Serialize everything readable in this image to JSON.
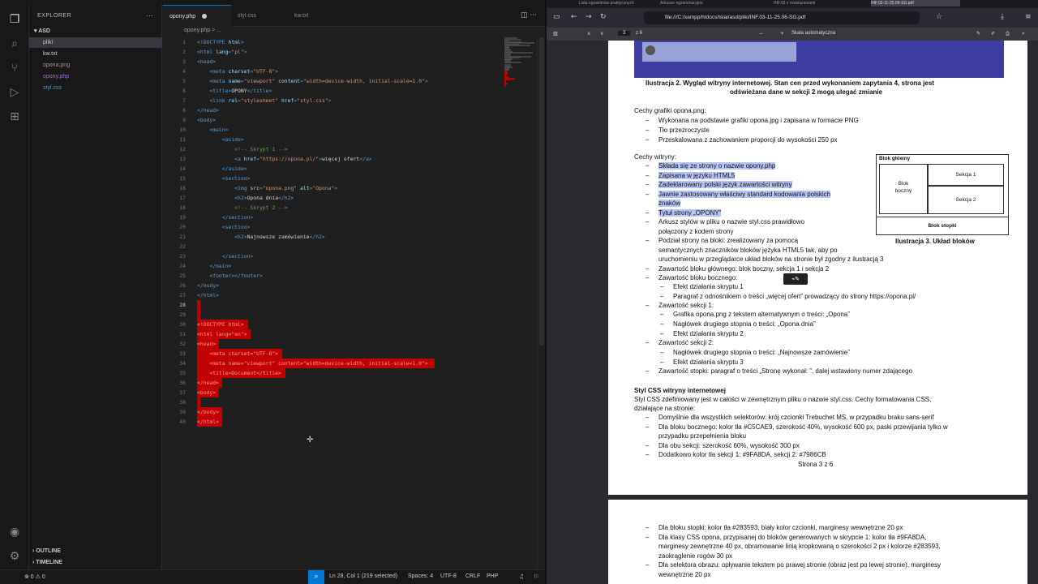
{
  "vscode": {
    "explorer_title": "EXPLORER",
    "root_folder": "ASD",
    "files": [
      {
        "name": "pliki",
        "kind": "folder",
        "color": "#c5c5c5"
      },
      {
        "name": "kw.txt",
        "kind": "txt",
        "color": "#cccccc"
      },
      {
        "name": "opona.png",
        "kind": "png",
        "color": "#b48ead"
      },
      {
        "name": "opony.php",
        "kind": "php",
        "color": "#a074c4"
      },
      {
        "name": "styl.css",
        "kind": "css",
        "color": "#519aba"
      }
    ],
    "outline_label": "OUTLINE",
    "timeline_label": "TIMELINE",
    "tabs": [
      {
        "label": "opony.php",
        "active": true,
        "dirty": true
      },
      {
        "label": "styl.css",
        "active": false,
        "dirty": false
      },
      {
        "label": "kw.txt",
        "active": false,
        "dirty": false
      }
    ],
    "breadcrumb": "opony.php > ...",
    "code_lines": [
      {
        "n": "1",
        "html": "<span class='kw'>&lt;!DOCTYPE</span> <span class='at'>html</span><span class='kw'>&gt;</span>"
      },
      {
        "n": "2",
        "html": "<span class='kw'>&lt;html</span> <span class='at'>lang</span>=<span class='st'>\"pl\"</span><span class='kw'>&gt;</span>"
      },
      {
        "n": "3",
        "html": "<span class='kw'>&lt;head&gt;</span>"
      },
      {
        "n": "4",
        "html": "    <span class='kw'>&lt;meta</span> <span class='at'>charset</span>=<span class='st'>\"UTF-8\"</span><span class='kw'>&gt;</span>"
      },
      {
        "n": "5",
        "html": "    <span class='kw'>&lt;meta</span> <span class='at'>name</span>=<span class='st'>\"viewport\"</span> <span class='at'>content</span>=<span class='st'>\"width=device-width, initial-scale=1.0\"</span><span class='kw'>&gt;</span>"
      },
      {
        "n": "6",
        "html": "    <span class='kw'>&lt;title&gt;</span><span class='tx'>OPONY</span><span class='kw'>&lt;/title&gt;</span>"
      },
      {
        "n": "7",
        "html": "    <span class='kw'>&lt;link</span> <span class='at'>rel</span>=<span class='st'>\"stylesheet\"</span> <span class='at'>href</span>=<span class='st'>\"styl.css\"</span><span class='kw'>&gt;</span>"
      },
      {
        "n": "8",
        "html": "<span class='kw'>&lt;/head&gt;</span>"
      },
      {
        "n": "9",
        "html": "<span class='kw'>&lt;body&gt;</span>"
      },
      {
        "n": "10",
        "html": "    <span class='kw'>&lt;main&gt;</span>"
      },
      {
        "n": "11",
        "html": "        <span class='kw'>&lt;aside&gt;</span>"
      },
      {
        "n": "12",
        "html": "            <span class='cm'>&lt;!-- Skrypt 1 --&gt;</span>"
      },
      {
        "n": "13",
        "html": "            <span class='kw'>&lt;a</span> <span class='at'>href</span>=<span class='st'>\"https://opona.pl/\"</span><span class='kw'>&gt;</span><span class='tx'>więcej ofert</span><span class='kw'>&lt;/a&gt;</span>"
      },
      {
        "n": "14",
        "html": "        <span class='kw'>&lt;/aside&gt;</span>"
      },
      {
        "n": "15",
        "html": "        <span class='kw'>&lt;section&gt;</span>"
      },
      {
        "n": "16",
        "html": "            <span class='kw'>&lt;img</span> <span class='at'>src</span>=<span class='st'>\"opona.png\"</span> <span class='at'>alt</span>=<span class='st'>\"Opona\"</span><span class='kw'>&gt;</span>"
      },
      {
        "n": "17",
        "html": "            <span class='kw'>&lt;h2&gt;</span><span class='tx'>Opona dnia</span><span class='kw'>&lt;/h2&gt;</span>"
      },
      {
        "n": "18",
        "html": "            <span class='cm'>&lt;!-- Skrypt 2 --&gt;</span>"
      },
      {
        "n": "19",
        "html": "        <span class='kw'>&lt;/section&gt;</span>"
      },
      {
        "n": "20",
        "html": "        <span class='kw'>&lt;section&gt;</span>"
      },
      {
        "n": "21",
        "html": "            <span class='kw'>&lt;h2&gt;</span><span class='tx'>Najnowsze zamówienie</span><span class='kw'>&lt;/h2&gt;</span>"
      },
      {
        "n": "22",
        "html": ""
      },
      {
        "n": "23",
        "html": "        <span class='kw'>&lt;/section&gt;</span>"
      },
      {
        "n": "24",
        "html": "    <span class='kw'>&lt;/main&gt;</span>"
      },
      {
        "n": "25",
        "html": "    <span class='kw'>&lt;footer&gt;&lt;/footer&gt;</span>"
      },
      {
        "n": "26",
        "html": "<span class='kw'>&lt;/body&gt;</span>"
      },
      {
        "n": "27",
        "html": "<span class='kw'>&lt;/html&gt;</span>"
      },
      {
        "n": "28",
        "html": "",
        "selected": true,
        "cur": true
      },
      {
        "n": "29",
        "html": "",
        "selected": true
      },
      {
        "n": "30",
        "html": "&lt;!DOCTYPE html&gt;",
        "selected": true
      },
      {
        "n": "31",
        "html": "&lt;html lang=\"en\"&gt;",
        "selected": true
      },
      {
        "n": "32",
        "html": "&lt;head&gt;",
        "selected": true
      },
      {
        "n": "33",
        "html": "    &lt;meta charset=\"UTF-8\"&gt;",
        "selected": true
      },
      {
        "n": "34",
        "html": "    &lt;meta name=\"viewport\" content=\"width=device-width, initial-scale=1.0\"&gt;",
        "selected": true
      },
      {
        "n": "35",
        "html": "    &lt;title&gt;Document&lt;/title&gt;",
        "selected": true
      },
      {
        "n": "36",
        "html": "&lt;/head&gt;",
        "selected": true
      },
      {
        "n": "37",
        "html": "&lt;body&gt;",
        "selected": true
      },
      {
        "n": "38",
        "html": "",
        "selected": true
      },
      {
        "n": "39",
        "html": "&lt;/body&gt;",
        "selected": true
      },
      {
        "n": "40",
        "html": "&lt;/html&gt;",
        "selected": true
      }
    ],
    "status": {
      "errors": "⊗ 0 ⚠ 0",
      "position": "Ln 28, Col 1 (219 selected)",
      "spaces": "Spaces: 4",
      "encoding": "UTF-8",
      "eol": "CRLF",
      "language": "PHP"
    }
  },
  "browser": {
    "tabs": [
      "Lista egzaminów praktycznych",
      "Arkusze egzaminacyjne",
      "INF.03 z rozwiązaniami",
      "INF.03-11-25.06-SG.pdf"
    ],
    "url": "file:///C:/xampp/htdocs/tsiai/asd/pliki/INF.03-11-25.06-SG.pdf",
    "page_current": "3",
    "page_total": "z 6",
    "zoom_label": "Skala automatyczna",
    "pdf": {
      "fig2_caption_1": "Ilustracja 2. Wygląd witryny internetowej. Stan cen przed wykonaniem zapytania 4, strona jest",
      "fig2_caption_2": "odświeżana dane w sekcji 2 mogą ulegać zmianie",
      "graphics_heading": "Cechy grafiki opona.png:",
      "graphics_items": [
        "Wykonana na podstawie grafiki opona.jpg i zapisana w formacie PNG",
        "Tło przezroczyste",
        "Przeskalowana z zachowaniem proporcji do wysokości 250 px"
      ],
      "site_heading": "Cechy witryny:",
      "site_items_hl": [
        "Składa się ze strony o nazwie opony.php",
        "Zapisana w języku HTML5",
        "Zadeklarowany polski język zawartości witryny",
        "Jawnie zastosowany właściwy standard kodowania polskich",
        "znaków",
        "Tytuł strony „OPONY”"
      ],
      "site_items_rest": [
        "Arkusz stylów w pliku o nazwie styl.css prawidłowo",
        "połączony z kodem strony",
        "Podział strony na bloki: zrealizowany za pomocą",
        "semantycznych znaczników bloków języka HTML5 tak, aby po",
        "uruchomieniu w przeglądarce układ bloków na stronie był zgodny z ilustracją 3",
        "Zawartość bloku głównego: blok boczny, sekcja 1 i sekcja 2",
        "Zawartość bloku bocznego:"
      ],
      "side_sub": [
        "Efekt działania skryptu 1",
        "Paragraf z odnośnikiem o treści „więcej ofert” prowadzący do strony https://opona.pl/"
      ],
      "sec1_heading": "Zawartość sekcji 1:",
      "sec1_sub": [
        "Grafika opona.png z tekstem alternatywnym o treści: „Opona”",
        "Nagłówek drugiego stopnia o treści: „Opona dnia”",
        "Efekt działania skryptu 2"
      ],
      "sec2_heading": "Zawartość sekcji 2:",
      "sec2_sub": [
        "Nagłówek drugiego stopnia o treści: „Najnowsze zamówienie”",
        "Efekt działania skryptu 3"
      ],
      "footer_item": "Zawartość stopki: paragraf o treści „Stronę wykonał: ”, dalej wstawiony numer zdającego",
      "css_heading": "Styl CSS witryny internetowej",
      "css_intro_1": "Styl CSS zdefiniowany jest w całości w zewnętrznym pliku o nazwie styl.css. Cechy formatowania CSS,",
      "css_intro_2": "działające na stronie:",
      "css_items": [
        "Domyślnie dla wszystkich selektorów: krój czcionki Trebuchet MS, w przypadku braku sans-serif",
        "Dla bloku bocznego: kolor tła #C5CAE9, szerokość 40%, wysokość 600 px, paski przewijania tylko w",
        "przypadku przepełnienia bloku",
        "Dla obu sekcji: szerokość 60%, wysokość 300 px",
        "Dodatkowo kolor tła sekcji 1: #9FA8DA, sekcji 2: #7986CB"
      ],
      "page_label": "Strona 3 z 6",
      "diagram": {
        "main": "Blok główny",
        "side_1": "Blok",
        "side_2": "boczny",
        "sec1": "Sekcja 1",
        "sec2": "Sekcja 2",
        "footer": "Blok stopki",
        "caption": "Ilustracja 3. Układ bloków"
      },
      "page2_items": [
        "Dla bloku stopki: kolor tła #283593, biały kolor czcionki, marginesy wewnętrzne 20 px",
        "Dla klasy CSS opona, przypisanej do bloków generowanych w skrypcie 1: kolor tła #9FA8DA,",
        "marginesy zewnętrzne 40 px, obramowanie linią kropkowaną o szerokości 2 px i kolorze #283593,",
        "zaokrąglenie rogów 30 px",
        "Dla selektora obrazu: opływanie tekstem po prawej stronie (obraz jest po lewej stronie), marginesy",
        "wewnętrzne 20 px"
      ]
    }
  }
}
